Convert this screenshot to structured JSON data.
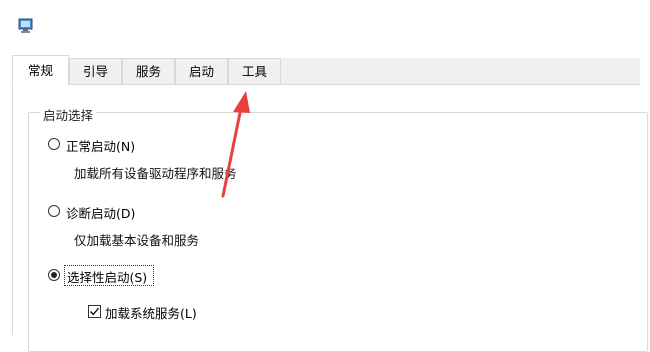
{
  "window": {
    "app_icon": "msconfig-computer-icon"
  },
  "tabs": [
    {
      "label": "常规",
      "active": true
    },
    {
      "label": "引导",
      "active": false
    },
    {
      "label": "服务",
      "active": false
    },
    {
      "label": "启动",
      "active": false
    },
    {
      "label": "工具",
      "active": false
    }
  ],
  "startup_selection": {
    "title": "启动选择",
    "options": [
      {
        "label": "正常启动(N)",
        "description": "加载所有设备驱动程序和服务",
        "selected": false
      },
      {
        "label": "诊断启动(D)",
        "description": "仅加载基本设备和服务",
        "selected": false
      },
      {
        "label": "选择性启动(S)",
        "selected": true
      }
    ],
    "checkboxes": [
      {
        "label": "加载系统服务(L)",
        "checked": true
      }
    ]
  },
  "annotation": {
    "icon": "red-arrow-icon",
    "color": "#e8413c",
    "points_to": "工具"
  }
}
